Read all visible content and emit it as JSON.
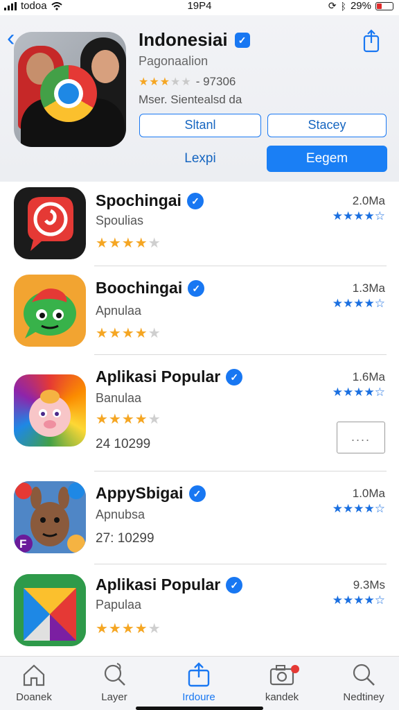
{
  "status_bar": {
    "carrier": "todoa",
    "time": "19P4",
    "battery": "29%"
  },
  "header": {
    "back_icon": "chevron-left-icon",
    "title": "Indonesiai",
    "subtitle": "Pagonaalion",
    "rating_text": "- 97306",
    "rating_stars": 3,
    "meta": "Mser. Sientealsd da",
    "button_left": "Sltanl",
    "button_right": "Stacey",
    "link": "Lexpi",
    "primary_button": "Eegem",
    "accent": "#1877f2"
  },
  "apps": [
    {
      "name": "Spochingai",
      "subtitle": "Spoulias",
      "stars": 4,
      "size": "2.0Ma",
      "code": ""
    },
    {
      "name": "Boochingai",
      "subtitle": "Apnulaa",
      "stars": 4,
      "size": "1.3Ma",
      "code": ""
    },
    {
      "name": "Aplikasi Popular",
      "subtitle": "Banulaa",
      "stars": 4,
      "size": "1.6Ma",
      "code": "24 10299",
      "more": "...."
    },
    {
      "name": "AppySbigai",
      "subtitle": "Apnubsa",
      "stars": 0,
      "size": "1.0Ma",
      "code": "27: 10299"
    },
    {
      "name": "Aplikasi Popular",
      "subtitle": "Papulaa",
      "stars": 4,
      "size": "9.3Ms",
      "code": ""
    }
  ],
  "tabs": [
    {
      "label": "Doanek",
      "icon": "home-icon"
    },
    {
      "label": "Layer",
      "icon": "search-leaf-icon"
    },
    {
      "label": "Irdoure",
      "icon": "upload-icon",
      "active": true
    },
    {
      "label": "kandek",
      "icon": "camera-icon",
      "badge": true
    },
    {
      "label": "Nedtiney",
      "icon": "search-icon"
    }
  ]
}
